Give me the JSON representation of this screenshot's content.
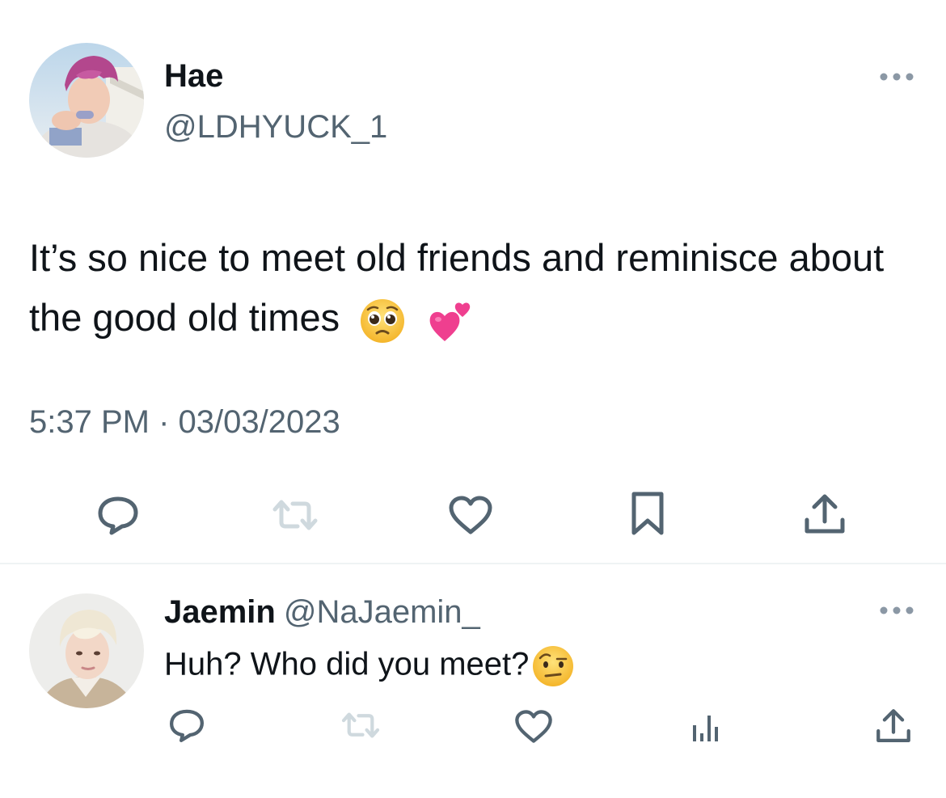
{
  "main_tweet": {
    "display_name": "Hae",
    "handle": "@LDHYUCK_1",
    "text": "It’s so nice to meet old friends and reminisce about the good old times",
    "emojis": [
      "pleading-face",
      "two-hearts"
    ],
    "timestamp": "5:37 PM · 03/03/2023",
    "actions": [
      "reply-icon",
      "retweet-icon",
      "like-icon",
      "bookmark-icon",
      "share-icon"
    ]
  },
  "reply_tweet": {
    "display_name": "Jaemin",
    "handle": "@NaJaemin_",
    "text": "Huh? Who did you meet?",
    "emojis": [
      "face-with-raised-eyebrow"
    ],
    "actions": [
      "reply-icon",
      "retweet-icon",
      "like-icon",
      "views-icon",
      "share-icon"
    ]
  },
  "colors": {
    "text_primary": "#0f1419",
    "text_secondary": "#536471",
    "icon_gray": "#536471",
    "icon_light": "#cfd9de",
    "divider": "#eff3f4"
  }
}
